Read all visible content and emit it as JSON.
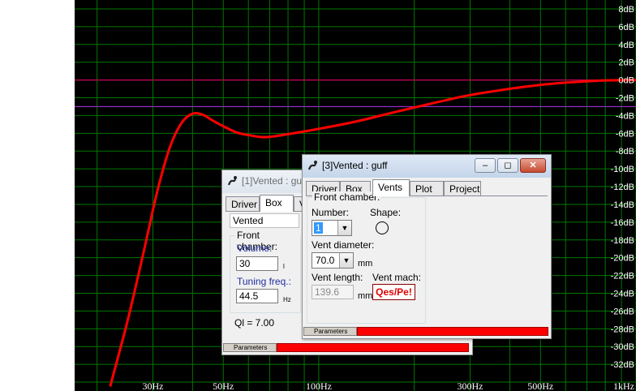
{
  "chart_data": {
    "type": "line",
    "xscale": "log",
    "xlim": [
      17,
      1000
    ],
    "ylim": [
      -35,
      9
    ],
    "grid": true,
    "x_tick_labels": [
      {
        "value": 30,
        "label": "30Hz"
      },
      {
        "value": 50,
        "label": "50Hz"
      },
      {
        "value": 100,
        "label": "100Hz"
      },
      {
        "value": 300,
        "label": "300Hz"
      },
      {
        "value": 500,
        "label": "500Hz"
      },
      {
        "value": 1000,
        "label": "1kHz"
      }
    ],
    "y_tick_labels": [
      {
        "value": 8,
        "label": "8dB"
      },
      {
        "value": 6,
        "label": "6dB"
      },
      {
        "value": 4,
        "label": "4dB"
      },
      {
        "value": 2,
        "label": "2dB"
      },
      {
        "value": 0,
        "label": "0dB"
      },
      {
        "value": -2,
        "label": "-2dB"
      },
      {
        "value": -4,
        "label": "-4dB"
      },
      {
        "value": -6,
        "label": "-6dB"
      },
      {
        "value": -8,
        "label": "-8dB"
      },
      {
        "value": -10,
        "label": "-10dB"
      },
      {
        "value": -12,
        "label": "-12dB"
      },
      {
        "value": -14,
        "label": "-14dB"
      },
      {
        "value": -16,
        "label": "-16dB"
      },
      {
        "value": -18,
        "label": "-18dB"
      },
      {
        "value": -20,
        "label": "-20dB"
      },
      {
        "value": -22,
        "label": "-22dB"
      },
      {
        "value": -24,
        "label": "-24dB"
      },
      {
        "value": -26,
        "label": "-26dB"
      },
      {
        "value": -28,
        "label": "-28dB"
      },
      {
        "value": -30,
        "label": "-30dB"
      },
      {
        "value": -32,
        "label": "-32dB"
      }
    ],
    "reference_lines": [
      {
        "y": 0,
        "color": "#c8005a"
      },
      {
        "y": -3,
        "color": "#9a2fd0"
      }
    ],
    "series": [
      {
        "color": "#ff0000",
        "x": [
          22,
          25,
          28,
          31,
          34,
          37,
          40,
          43,
          46,
          50,
          55,
          60,
          65,
          70,
          80,
          100,
          130,
          170,
          200,
          250,
          300,
          400,
          500,
          600,
          700,
          800,
          1000
        ],
        "y": [
          -34.5,
          -27,
          -19.5,
          -12.5,
          -7.5,
          -4.8,
          -3.8,
          -3.9,
          -4.5,
          -5.2,
          -5.9,
          -6.2,
          -6.4,
          -6.4,
          -6.1,
          -5.5,
          -4.7,
          -3.7,
          -3.1,
          -2.3,
          -1.7,
          -1.0,
          -0.55,
          -0.3,
          -0.15,
          -0.05,
          0
        ]
      }
    ]
  },
  "colors": {
    "plot_bg": "#000000",
    "grid": "#007800",
    "axis_text": "#ffffff",
    "left_margin": "#ffffff"
  },
  "window1": {
    "title": "[1]Vented : guff",
    "tabs": [
      "Driver",
      "Box",
      "Vents"
    ],
    "active_tab": "Box",
    "box_type": "Vented",
    "group_label": "Front chamber:",
    "volume_label": "Volume:",
    "volume_value": "30",
    "volume_unit": "l",
    "tuning_label": "Tuning freq.:",
    "tuning_value": "44.5",
    "tuning_unit": "Hz",
    "ql_text": "Ql = 7.00",
    "status_label": "Parameters"
  },
  "window3": {
    "title": "[3]Vented : guff",
    "tabs": [
      "Driver",
      "Box",
      "Vents",
      "Plot",
      "Project"
    ],
    "active_tab": "Vents",
    "group_label": "Front chamber:",
    "number_label": "Number:",
    "number_value": "1",
    "shape_label": "Shape:",
    "vent_diameter_label": "Vent diameter:",
    "vent_diameter_value": "70.0",
    "vent_diameter_unit": "mm",
    "vent_length_label": "Vent length:",
    "vent_length_value": "139.6",
    "vent_length_unit": "mm",
    "vent_mach_label": "Vent mach:",
    "vent_mach_button": "Qes/Pe!",
    "status_label": "Parameters",
    "icons": {
      "minimize": "minimize-icon",
      "maximize": "maximize-icon",
      "close": "close-icon"
    }
  }
}
